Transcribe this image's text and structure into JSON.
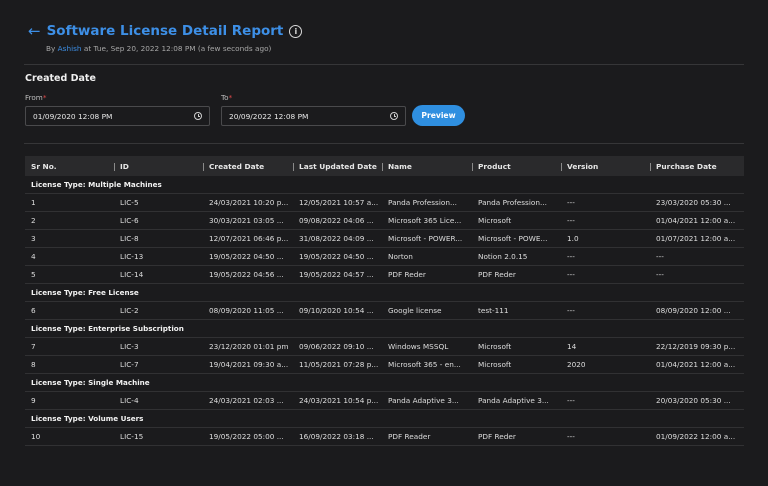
{
  "header": {
    "back_glyph": "←",
    "title": "Software License Detail Report",
    "info_glyph": "i",
    "by_prefix": "By ",
    "author": "Ashish",
    "by_suffix": " at Tue, Sep 20, 2022 12:08 PM (a few seconds ago)"
  },
  "filters": {
    "section_title": "Created Date",
    "from_label": "From",
    "to_label": "To",
    "required_mark": "*",
    "from_value": "01/09/2020 12:08 PM",
    "to_value": "20/09/2022 12:08 PM",
    "preview_label": "Preview"
  },
  "table": {
    "columns": [
      "Sr No.",
      "ID",
      "Created Date",
      "Last Updated Date",
      "Name",
      "Product",
      "Version",
      "Purchase Date"
    ],
    "groups": [
      {
        "label": "License Type: Multiple Machines",
        "rows": [
          [
            "1",
            "LIC-5",
            "24/03/2021 10:20 p...",
            "12/05/2021 10:57 a...",
            "Panda Profession...",
            "Panda Profession...",
            "---",
            "23/03/2020 05:30 ..."
          ],
          [
            "2",
            "LIC-6",
            "30/03/2021 03:05 ...",
            "09/08/2022 04:06 ...",
            "Microsoft 365 Lice...",
            "Microsoft",
            "---",
            "01/04/2021 12:00 a..."
          ],
          [
            "3",
            "LIC-8",
            "12/07/2021 06:46 p...",
            "31/08/2022 04:09 ...",
            "Microsoft - POWER...",
            "Microsoft - POWE...",
            "1.0",
            "01/07/2021 12:00 a..."
          ],
          [
            "4",
            "LIC-13",
            "19/05/2022 04:50 ...",
            "19/05/2022 04:50 ...",
            "Norton",
            "Notion 2.0.15",
            "---",
            "---"
          ],
          [
            "5",
            "LIC-14",
            "19/05/2022 04:56 ...",
            "19/05/2022 04:57 ...",
            "PDF Reder",
            "PDF Reder",
            "---",
            "---"
          ]
        ]
      },
      {
        "label": "License Type: Free License",
        "rows": [
          [
            "6",
            "LIC-2",
            "08/09/2020 11:05 ...",
            "09/10/2020 10:54 ...",
            "Google license",
            "test-111",
            "---",
            "08/09/2020 12:00 ..."
          ]
        ]
      },
      {
        "label": "License Type: Enterprise Subscription",
        "rows": [
          [
            "7",
            "LIC-3",
            "23/12/2020 01:01 pm",
            "09/06/2022 09:10 ...",
            "Windows MSSQL",
            "Microsoft",
            "14",
            "22/12/2019 09:30 p..."
          ],
          [
            "8",
            "LIC-7",
            "19/04/2021 09:30 a...",
            "11/05/2021 07:28 p...",
            "Microsoft 365 - en...",
            "Microsoft",
            "2020",
            "01/04/2021 12:00 a..."
          ]
        ]
      },
      {
        "label": "License Type: Single Machine",
        "rows": [
          [
            "9",
            "LIC-4",
            "24/03/2021 02:03 ...",
            "24/03/2021 10:54 p...",
            "Panda Adaptive 3...",
            "Panda Adaptive 3...",
            "---",
            "20/03/2020 05:30 ..."
          ]
        ]
      },
      {
        "label": "License Type: Volume Users",
        "rows": [
          [
            "10",
            "LIC-15",
            "19/05/2022 05:00 ...",
            "16/09/2022 03:18 ...",
            "PDF Reader",
            "PDF Reder",
            "---",
            "01/09/2022 12:00 a..."
          ]
        ]
      }
    ]
  }
}
